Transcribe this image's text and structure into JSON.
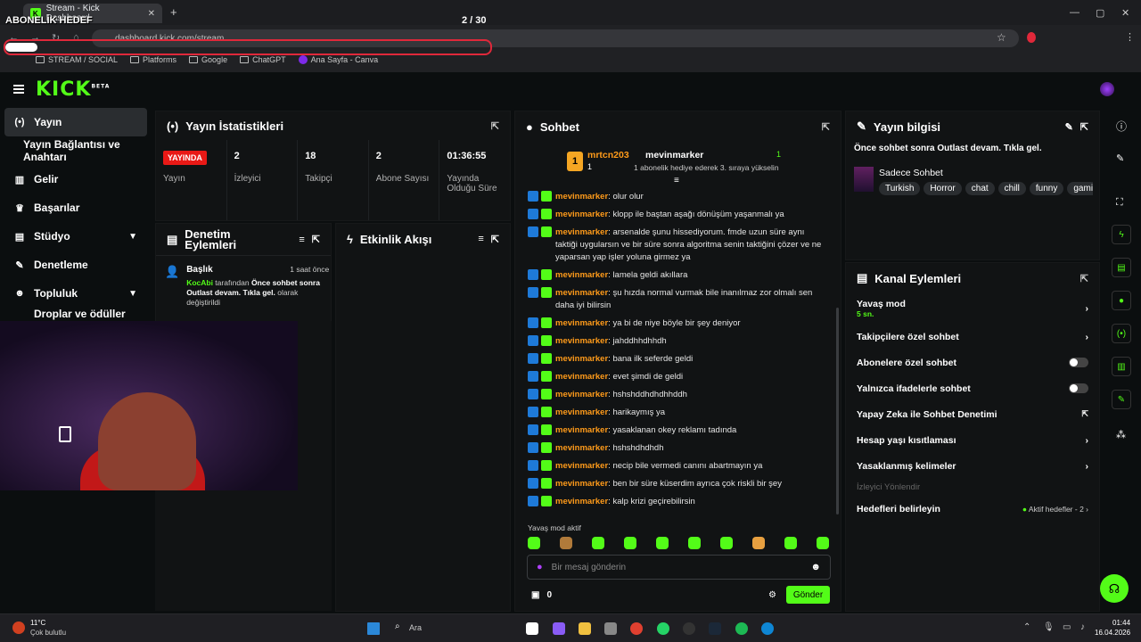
{
  "browser": {
    "tab_title": "Stream - Kick Dashboard",
    "overlay_goal": "ABONELİK HEDEF",
    "overlay_count": "2 / 30",
    "url": "dashboard.kick.com/stream",
    "bookmarks": [
      "STREAM / SOCIAL",
      "Platforms",
      "Google",
      "ChatGPT",
      "Ana Sayfa - Canva"
    ]
  },
  "header": {
    "logo": "KICK",
    "logo_beta": "BETA"
  },
  "sidebar": {
    "items": [
      {
        "label": "Yayın",
        "icon": "broadcast-icon"
      },
      {
        "label": "Yayın Bağlantısı ve Anahtarı",
        "icon": ""
      },
      {
        "label": "Gelir",
        "icon": "chart-icon"
      },
      {
        "label": "Başarılar",
        "icon": "trophy-icon"
      },
      {
        "label": "Stüdyo",
        "icon": "studio-icon"
      },
      {
        "label": "Denetleme",
        "icon": "wrench-icon"
      },
      {
        "label": "Topluluk",
        "icon": "people-icon"
      },
      {
        "label": "Droplar ve ödüller",
        "icon": "gift-icon"
      }
    ]
  },
  "stats_panel": {
    "title": "Yayın İstatistikleri",
    "live_badge": "YAYINDA",
    "live_label": "Yayın",
    "stats": [
      {
        "value": "2",
        "label": "İzleyici"
      },
      {
        "value": "18",
        "label": "Takipçi"
      },
      {
        "value": "2",
        "label": "Abone Sayısı"
      },
      {
        "value": "01:36:55",
        "label": "Yayında Olduğu Süre"
      }
    ]
  },
  "mod_panel": {
    "title": "Denetim Eylemleri",
    "entry_title": "Başlık",
    "entry_time": "1 saat önce",
    "entry_user": "KocAbi",
    "entry_text1": " tarafından ",
    "entry_bold": "Önce sohbet sonra Outlast devam. Tıkla gel.",
    "entry_text2": " olarak değiştirildi"
  },
  "activity_panel": {
    "title": "Etkinlik Akışı"
  },
  "chat": {
    "title": "Sohbet",
    "top_gifter": "mrtcn203",
    "top_gifter_count": "1",
    "gift_user": "mevinmarker",
    "gift_text": "1 abonelik hediye ederek 3. sıraya yükselin",
    "gift_count": "1",
    "messages": [
      {
        "user": "mevinmarker",
        "text": "olur olur"
      },
      {
        "user": "mevinmarker",
        "text": "klopp ile baştan aşağı dönüşüm yaşanmalı ya"
      },
      {
        "user": "mevinmarker",
        "text": "arsenalde şunu hissediyorum. fmde uzun süre aynı taktiği uygularsın ve bir süre sonra algoritma senin taktiğini çözer ve ne yaparsan yap işler yoluna girmez ya"
      },
      {
        "user": "mevinmarker",
        "text": "lamela geldi akıllara"
      },
      {
        "user": "mevinmarker",
        "text": "şu hızda normal vurmak bile inanılmaz zor olmalı sen daha iyi bilirsin"
      },
      {
        "user": "mevinmarker",
        "text": "ya bi de niye böyle bir şey deniyor"
      },
      {
        "user": "mevinmarker",
        "text": "jahddhhdhhdh"
      },
      {
        "user": "mevinmarker",
        "text": "bana ilk seferde geldi"
      },
      {
        "user": "mevinmarker",
        "text": "evet şimdi de geldi"
      },
      {
        "user": "mevinmarker",
        "text": "hshshddhdhdhhddh"
      },
      {
        "user": "mevinmarker",
        "text": "harikaymış ya"
      },
      {
        "user": "mevinmarker",
        "text": "yasaklanan okey reklamı tadında"
      },
      {
        "user": "mevinmarker",
        "text": "hshshdhdhdh"
      },
      {
        "user": "mevinmarker",
        "text": "necip bile vermedi canını abartmayın ya"
      },
      {
        "user": "mevinmarker",
        "text": "ben bir süre küserdim ayrıca çok riskli bir şey"
      },
      {
        "user": "mevinmarker",
        "text": "kalp krizi geçirebilirsin"
      }
    ],
    "slow_mode": "Yavaş mod aktif",
    "input_placeholder": "Bir mesaj gönderin",
    "points": "0",
    "send": "Gönder"
  },
  "info_panel": {
    "title": "Yayın bilgisi",
    "stream_title": "Önce sohbet sonra Outlast devam. Tıkla gel.",
    "category": "Sadece Sohbet",
    "tags": [
      "Turkish",
      "Horror",
      "chat",
      "chill",
      "funny",
      "gaming"
    ]
  },
  "channel_panel": {
    "title": "Kanal Eylemleri",
    "slow_label": "Yavaş mod",
    "slow_value": "5 sn.",
    "rows": [
      "Takipçilere özel sohbet",
      "Abonelere özel sohbet",
      "Yalnızca ifadelerle sohbet",
      "Yapay Zeka ile Sohbet Denetimi",
      "Hesap yaşı kısıtlaması",
      "Yasaklanmış kelimeler"
    ],
    "section": "İzleyici Yönlendir",
    "goals_label": "Hedefleri belirleyin",
    "goals_value": "Aktif hedefler - 2"
  },
  "taskbar": {
    "weather_temp": "11°C",
    "weather_desc": "Çok bulutlu",
    "search": "Ara",
    "time": "01:44",
    "date": "16.04.2026"
  },
  "colors": {
    "accent": "#53fc18",
    "live": "#e91916",
    "username": "#ff9b1a"
  }
}
